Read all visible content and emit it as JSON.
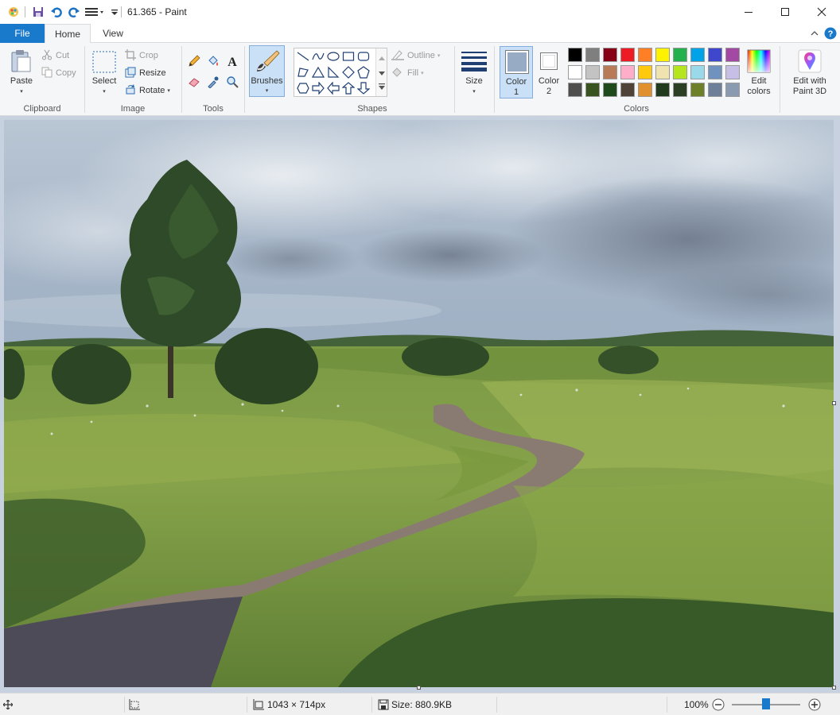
{
  "window": {
    "title": "61.365 - Paint"
  },
  "tabs": [
    {
      "label": "File"
    },
    {
      "label": "Home"
    },
    {
      "label": "View"
    }
  ],
  "ribbon": {
    "clipboard": {
      "label": "Clipboard",
      "paste": "Paste",
      "cut": "Cut",
      "copy": "Copy"
    },
    "image": {
      "label": "Image",
      "select": "Select",
      "crop": "Crop",
      "resize": "Resize",
      "rotate": "Rotate"
    },
    "tools": {
      "label": "Tools"
    },
    "brushes": {
      "label": "Brushes"
    },
    "shapes": {
      "label": "Shapes",
      "outline": "Outline",
      "fill": "Fill"
    },
    "size": {
      "label": "Size"
    },
    "colors": {
      "label": "Colors",
      "color1": "Color",
      "color1_num": "1",
      "color2": "Color",
      "color2_num": "2",
      "edit_colors_1": "Edit",
      "edit_colors_2": "colors",
      "color1_value": "#98abc4",
      "color2_value": "#ffffff",
      "palette_row1": [
        "#000000",
        "#7f7f7f",
        "#880015",
        "#ed1c24",
        "#ff7f27",
        "#fff200",
        "#22b14c",
        "#00a2e8",
        "#3f48cc",
        "#a349a4"
      ],
      "palette_row2": [
        "#ffffff",
        "#c3c3c3",
        "#b97a57",
        "#ffaec9",
        "#ffc90e",
        "#efe4b0",
        "#b5e61d",
        "#99d9ea",
        "#7092be",
        "#c8bfe7"
      ],
      "palette_row3": [
        "#4e4e4e",
        "#38531f",
        "#1f4a1c",
        "#4f4338",
        "#e0902c",
        "#1f3a1c",
        "#2b3f23",
        "#6e7f2a",
        "#6e7f9a",
        "#8a9ab0"
      ]
    },
    "paint3d": {
      "line1": "Edit with",
      "line2": "Paint 3D"
    }
  },
  "status": {
    "dimensions": "1043 × 714px",
    "size": "Size: 880.9KB",
    "zoom": "100%"
  },
  "canvas": {
    "description_colors": {
      "sky_top": "#aebccc",
      "sky_low": "#9aa8bb",
      "field": "#7a9a3e",
      "path": "#8a7a72"
    }
  }
}
